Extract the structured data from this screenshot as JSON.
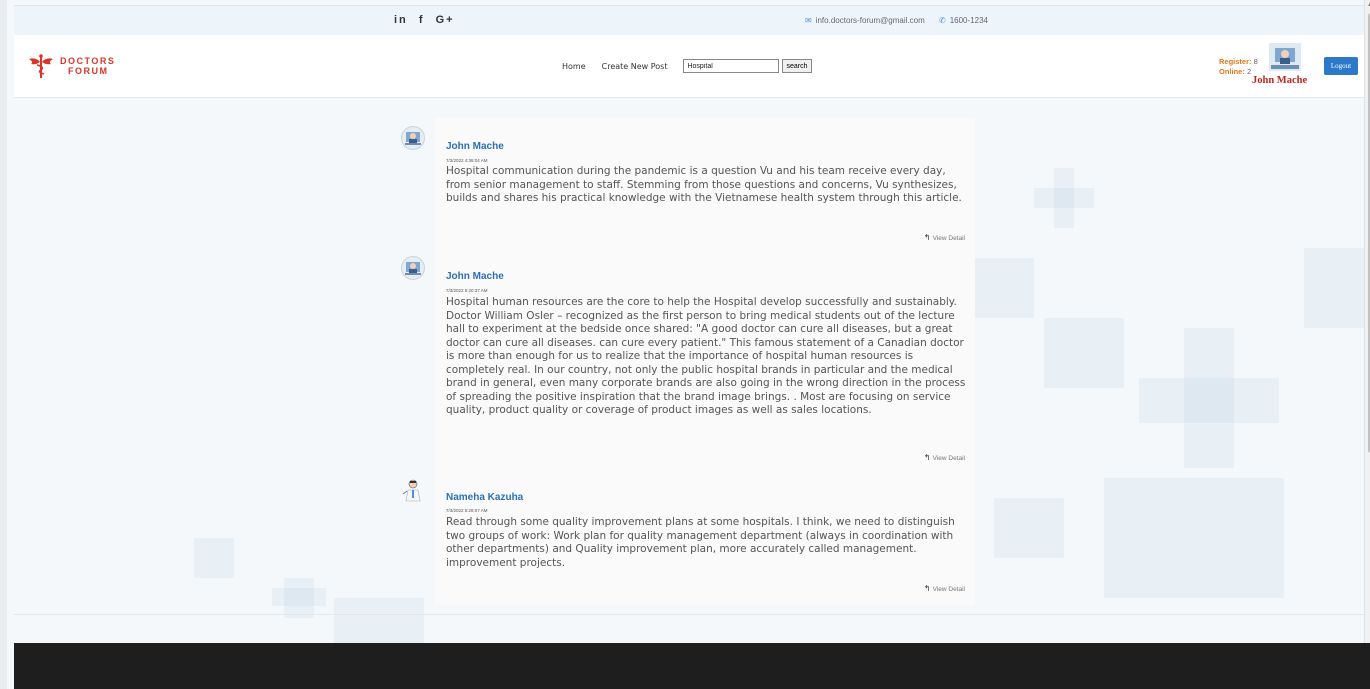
{
  "topbar": {
    "social": [
      "in",
      "f",
      "G+"
    ],
    "email": "info.doctors-forum@gmail.com",
    "phone": "1600-1234"
  },
  "logo": {
    "line1": "DOCTORS",
    "line2": "FORUM"
  },
  "nav": {
    "home": "Home",
    "create_post": "Create New Post",
    "search_value": "Hospital",
    "search_button": "search"
  },
  "stats": {
    "register_label": "Register:",
    "register_count": "8",
    "online_label": "Online:",
    "online_count": "2"
  },
  "user": {
    "name": "John Mache",
    "logout": "Logout"
  },
  "posts": [
    {
      "author": "John Mache",
      "date": "7/3/2022 4:36:04 AM",
      "content": "Hospital communication during the pandemic is a question Vu and his team receive every day, from senior management to staff. Stemming from those questions and concerns, Vu synthesizes, builds and shares his practical knowledge with the Vietnamese health system through this article.",
      "link": "View Detail"
    },
    {
      "author": "John Mache",
      "date": "7/3/2022 5:20:37 AM",
      "content": "Hospital human resources are the core to help the Hospital develop successfully and sustainably. Doctor William Osler – recognized as the first person to bring medical students out of the lecture hall to experiment at the bedside once shared: \"A good doctor can cure all diseases, but a great doctor can cure all diseases. can cure every patient.\" This famous statement of a Canadian doctor is more than enough for us to realize that the importance of hospital human resources is completely real. In our country, not only the public hospital brands in particular and the medical brand in general, even many corporate brands are also going in the wrong direction in the process of spreading the positive inspiration that the brand image brings. . Most are focusing on service quality, product quality or coverage of product images as well as sales locations.",
      "link": "View Detail"
    },
    {
      "author": "Nameha Kazuha",
      "date": "7/3/2022 5:28:07 AM",
      "content": "Read through some quality improvement plans at some hospitals. I think, we need to distinguish two groups of work: Work plan for quality management department (always in coordination with other departments) and Quality improvement plan, more accurately called management. improvement projects.",
      "link": "View Detail"
    }
  ],
  "icons": {
    "email": "envelope-icon",
    "phone": "phone-icon",
    "reply": "reply-icon"
  },
  "colors": {
    "brand_red": "#d9352b",
    "link_blue": "#2a6fb8",
    "logout_blue": "#2c78c9",
    "stats_orange": "#e07a1a",
    "footer": "#1e1e1e"
  }
}
